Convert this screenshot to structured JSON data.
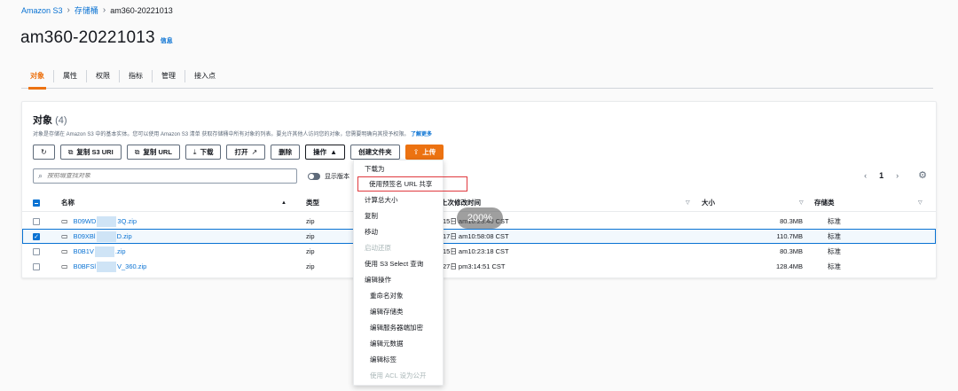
{
  "breadcrumb": {
    "root": "Amazon S3",
    "buckets": "存储桶",
    "current": "am360-20221013"
  },
  "title": {
    "text": "am360-20221013",
    "info": "信息"
  },
  "tabs": [
    "对象",
    "属性",
    "权限",
    "指标",
    "管理",
    "接入点"
  ],
  "objects": {
    "heading": "对象",
    "count": "(4)",
    "description": "对象是存储在 Amazon S3 中的基本实体。您可以使用 Amazon S3 清单 获取存储桶中所有对象的列表。要允许其他人访问您的对象，您需要明确向其授予权限。",
    "learn_more": "了解更多"
  },
  "toolbar": {
    "copy_s3_uri": "复制 S3 URI",
    "copy_url": "复制 URL",
    "download": "下载",
    "open": "打开",
    "delete": "删除",
    "actions": "操作",
    "create_folder": "创建文件夹",
    "upload": "上传"
  },
  "search": {
    "placeholder": "按前缀查找对象"
  },
  "toggle_label": "显示版本",
  "pager": {
    "page": "1"
  },
  "table": {
    "headers": {
      "name": "名称",
      "type": "类型",
      "modified": "上次修改时间",
      "size": "大小",
      "storage": "存储类"
    },
    "rows": [
      {
        "name_a": "B09WD",
        "name_b": "3Q.zip",
        "type": "zip",
        "modified": "15日 am10:23:40 CST",
        "size": "80.3MB",
        "storage": "标准",
        "selected": false
      },
      {
        "name_a": "B09XBl",
        "name_b": "D.zip",
        "type": "zip",
        "modified": "17日 am10:58:08 CST",
        "size": "110.7MB",
        "storage": "标准",
        "selected": true
      },
      {
        "name_a": "B0B1V",
        "name_b": ".zip",
        "type": "zip",
        "modified": "15日 am10:23:18 CST",
        "size": "80.3MB",
        "storage": "标准",
        "selected": false
      },
      {
        "name_a": "B0BFSl",
        "name_b": "V_360.zip",
        "type": "zip",
        "modified": "27日 pm3:14:51 CST",
        "size": "128.4MB",
        "storage": "标准",
        "selected": false
      }
    ]
  },
  "menu": {
    "items": [
      "下载为",
      "使用预签名 URL 共享",
      "计算总大小",
      "复制",
      "移动",
      "启动还原",
      "使用 S3 Select 查询",
      "编辑操作",
      "重命名对象",
      "编辑存储类",
      "编辑服务器端加密",
      "编辑元数据",
      "编辑标签",
      "使用 ACL 设为公开"
    ]
  },
  "zoom": "200%",
  "colors": {
    "accent": "#ec7211",
    "link": "#0972d3",
    "highlight": "#e0393e"
  }
}
